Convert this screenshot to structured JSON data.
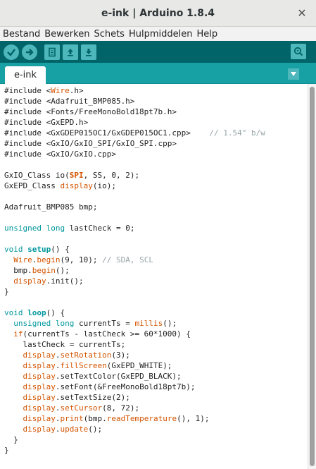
{
  "window": {
    "title": "e-ink | Arduino 1.8.4",
    "close_label": "✕"
  },
  "menubar": [
    "Bestand",
    "Bewerken",
    "Schets",
    "Hulpmiddelen",
    "Help"
  ],
  "tabs": [
    {
      "label": "e-ink"
    }
  ],
  "colors": {
    "toolbar_bg": "#006468",
    "tabbar_bg": "#17a1a5",
    "button_bg": "#4db7bb",
    "keyword": "#00979c",
    "function": "#d35400",
    "comment": "#95a5a6"
  },
  "toolbar": {
    "buttons": [
      "verify-icon",
      "upload-icon",
      "new-icon",
      "open-icon",
      "save-icon"
    ],
    "serial_monitor": "serial-monitor-icon"
  },
  "code_lines": [
    [
      [
        "#include <",
        ""
      ],
      [
        "Wire",
        "fn"
      ],
      [
        ".h>",
        ""
      ]
    ],
    [
      [
        "#include <Adafruit_BMP085.h>",
        ""
      ]
    ],
    [
      [
        "#include <Fonts/FreeMonoBold18pt7b.h>",
        ""
      ]
    ],
    [
      [
        "#include <GxEPD.h>",
        ""
      ]
    ],
    [
      [
        "#include <GxGDEP015OC1/GxGDEP015OC1.cpp>    ",
        ""
      ],
      [
        "// 1.54\" b/w",
        "cm"
      ]
    ],
    [
      [
        "#include <GxIO/GxIO_SPI/GxIO_SPI.cpp>",
        ""
      ]
    ],
    [
      [
        "#include <GxIO/GxIO.cpp>",
        ""
      ]
    ],
    [
      [
        "",
        ""
      ]
    ],
    [
      [
        "GxIO_Class io(",
        ""
      ],
      [
        "SPI",
        "fnb"
      ],
      [
        ", SS, 0, 2);",
        ""
      ]
    ],
    [
      [
        "GxEPD_Class ",
        ""
      ],
      [
        "display",
        "fn"
      ],
      [
        "(io);",
        ""
      ]
    ],
    [
      [
        "",
        ""
      ]
    ],
    [
      [
        "Adafruit_BMP085 bmp;",
        ""
      ]
    ],
    [
      [
        "",
        ""
      ]
    ],
    [
      [
        "unsigned",
        "kw"
      ],
      [
        " ",
        ""
      ],
      [
        "long",
        "kw"
      ],
      [
        " lastCheck = 0;",
        ""
      ]
    ],
    [
      [
        "",
        ""
      ]
    ],
    [
      [
        "void",
        "kw"
      ],
      [
        " ",
        ""
      ],
      [
        "setup",
        "kwb"
      ],
      [
        "() {",
        ""
      ]
    ],
    [
      [
        "  ",
        ""
      ],
      [
        "Wire",
        "fn"
      ],
      [
        ".",
        ""
      ],
      [
        "begin",
        "fn"
      ],
      [
        "(9, 10); ",
        ""
      ],
      [
        "// SDA, SCL",
        "cm"
      ]
    ],
    [
      [
        "  bmp.",
        ""
      ],
      [
        "begin",
        "fn"
      ],
      [
        "();",
        ""
      ]
    ],
    [
      [
        "  ",
        ""
      ],
      [
        "display",
        "fn"
      ],
      [
        ".init();",
        ""
      ]
    ],
    [
      [
        "}",
        ""
      ]
    ],
    [
      [
        "",
        ""
      ]
    ],
    [
      [
        "void",
        "kw"
      ],
      [
        " ",
        ""
      ],
      [
        "loop",
        "kwb"
      ],
      [
        "() {",
        ""
      ]
    ],
    [
      [
        "  ",
        ""
      ],
      [
        "unsigned",
        "kw"
      ],
      [
        " ",
        ""
      ],
      [
        "long",
        "kw"
      ],
      [
        " currentTs = ",
        ""
      ],
      [
        "millis",
        "fn"
      ],
      [
        "();",
        ""
      ]
    ],
    [
      [
        "  ",
        ""
      ],
      [
        "if",
        "fn"
      ],
      [
        "(currentTs - lastCheck >= 60*1000) {",
        ""
      ]
    ],
    [
      [
        "    lastCheck = currentTs;",
        ""
      ]
    ],
    [
      [
        "    ",
        ""
      ],
      [
        "display",
        "fn"
      ],
      [
        ".",
        ""
      ],
      [
        "setRotation",
        "fn"
      ],
      [
        "(3);",
        ""
      ]
    ],
    [
      [
        "    ",
        ""
      ],
      [
        "display",
        "fn"
      ],
      [
        ".",
        ""
      ],
      [
        "fillScreen",
        "fn"
      ],
      [
        "(GxEPD_WHITE);",
        ""
      ]
    ],
    [
      [
        "    ",
        ""
      ],
      [
        "display",
        "fn"
      ],
      [
        ".setTextColor(GxEPD_BLACK);",
        ""
      ]
    ],
    [
      [
        "    ",
        ""
      ],
      [
        "display",
        "fn"
      ],
      [
        ".setFont(&FreeMonoBold18pt7b);",
        ""
      ]
    ],
    [
      [
        "    ",
        ""
      ],
      [
        "display",
        "fn"
      ],
      [
        ".setTextSize(2);",
        ""
      ]
    ],
    [
      [
        "    ",
        ""
      ],
      [
        "display",
        "fn"
      ],
      [
        ".",
        ""
      ],
      [
        "setCursor",
        "fn"
      ],
      [
        "(8, 72);",
        ""
      ]
    ],
    [
      [
        "    ",
        ""
      ],
      [
        "display",
        "fn"
      ],
      [
        ".",
        ""
      ],
      [
        "print",
        "fn"
      ],
      [
        "(bmp.",
        ""
      ],
      [
        "readTemperature",
        "fn"
      ],
      [
        "(), 1);",
        ""
      ]
    ],
    [
      [
        "    ",
        ""
      ],
      [
        "display",
        "fn"
      ],
      [
        ".",
        ""
      ],
      [
        "update",
        "fn"
      ],
      [
        "();",
        ""
      ]
    ],
    [
      [
        "  }",
        ""
      ]
    ],
    [
      [
        "}",
        ""
      ]
    ]
  ]
}
